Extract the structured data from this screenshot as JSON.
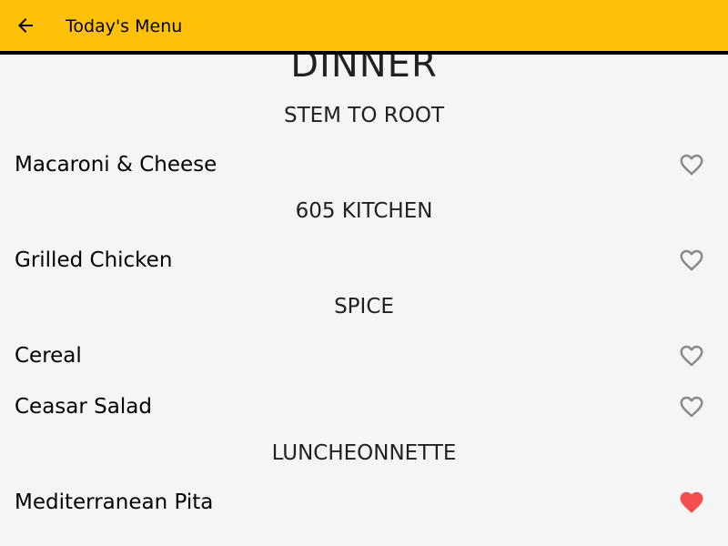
{
  "appbar": {
    "title": "Today's Menu",
    "back_icon": "arrow-back-icon",
    "color": "#ffc107"
  },
  "meal": "DINNER",
  "stations": [
    {
      "name": "STEM TO ROOT",
      "items": [
        {
          "name": "Macaroni & Cheese",
          "favorite": false
        }
      ]
    },
    {
      "name": "605 KITCHEN",
      "items": [
        {
          "name": "Grilled Chicken",
          "favorite": false
        }
      ]
    },
    {
      "name": "SPICE",
      "items": [
        {
          "name": "Cereal",
          "favorite": false
        },
        {
          "name": "Ceasar Salad",
          "favorite": false
        }
      ]
    },
    {
      "name": "LUNCHEONNETTE",
      "items": [
        {
          "name": "Mediterranean Pita",
          "favorite": true
        }
      ]
    }
  ],
  "colors": {
    "heart_outline": "#8a8a8a",
    "heart_filled": "#f44e4e"
  }
}
